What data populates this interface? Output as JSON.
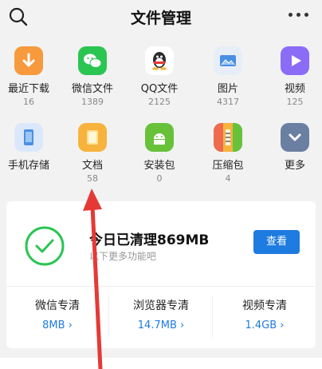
{
  "header": {
    "title": "文件管理",
    "icons": [
      "search-icon",
      "more-icon"
    ]
  },
  "categories": [
    {
      "label": "最近下载",
      "count": "16",
      "icon": "download-icon",
      "color": "#f79a3e"
    },
    {
      "label": "微信文件",
      "count": "1389",
      "icon": "wechat-icon",
      "color": "#2bc552"
    },
    {
      "label": "QQ文件",
      "count": "2125",
      "icon": "qq-icon",
      "color": "#2c2c2c"
    },
    {
      "label": "图片",
      "count": "4317",
      "icon": "image-icon",
      "color": "#4a90e2"
    },
    {
      "label": "视频",
      "count": "125",
      "icon": "video-icon",
      "color": "#8b6cf7"
    },
    {
      "label": "手机存储",
      "count": "",
      "icon": "phone-storage-icon",
      "color": "#4a90e2"
    },
    {
      "label": "文档",
      "count": "58",
      "icon": "document-icon",
      "color": "#f7b33e"
    },
    {
      "label": "安装包",
      "count": "0",
      "icon": "apk-icon",
      "color": "#67c23a"
    },
    {
      "label": "压缩包",
      "count": "4",
      "icon": "archive-icon",
      "color": "#ef6b4e"
    },
    {
      "label": "更多",
      "count": "",
      "icon": "more-chevron-icon",
      "color": "#6b7fa3"
    }
  ],
  "cleaner": {
    "title": "今日已清理869MB",
    "subtitle": "以下更多功能吧",
    "button": "查看"
  },
  "specials": [
    {
      "title": "微信专清",
      "size": "8MB"
    },
    {
      "title": "浏览器专清",
      "size": "14.7MB"
    },
    {
      "title": "视频专清",
      "size": "1.4GB"
    }
  ],
  "colors": {
    "accent": "#1e7be0",
    "success": "#2bc552",
    "annotation": "#e53935"
  }
}
